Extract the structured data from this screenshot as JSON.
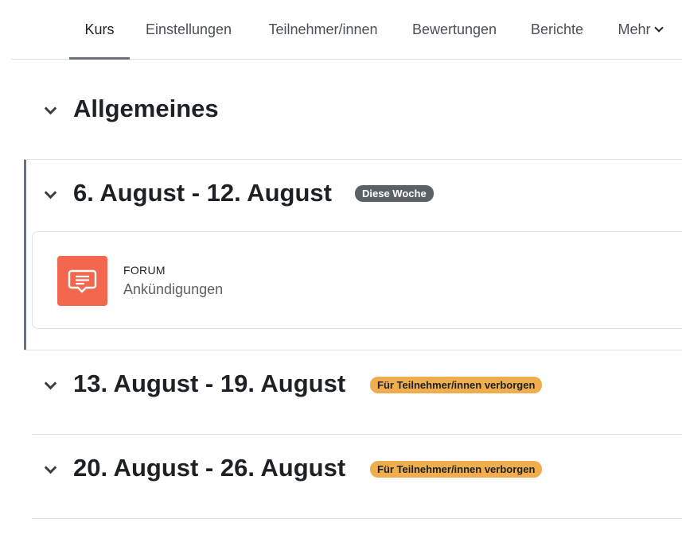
{
  "nav": {
    "tabs": [
      {
        "label": "Kurs",
        "active": true
      },
      {
        "label": "Einstellungen"
      },
      {
        "label": "Teilnehmer/innen"
      },
      {
        "label": "Bewertungen"
      },
      {
        "label": "Berichte"
      },
      {
        "label": "Mehr",
        "icon": "chevron-down-icon"
      }
    ]
  },
  "sections": [
    {
      "title": "Allgemeines",
      "icon": "chevron-down-icon"
    },
    {
      "title": "6. August - 12. August",
      "badge": "Diese Woche",
      "current": true,
      "icon": "chevron-down-icon",
      "activities": [
        {
          "type": "FORUM",
          "name": "Ankündigungen",
          "icon": "forum-icon"
        }
      ]
    },
    {
      "title": "13. August - 19. August",
      "badge": "Für Teilnehmer/innen verborgen",
      "icon": "chevron-down-icon"
    },
    {
      "title": "20. August - 26. August",
      "badge": "Für Teilnehmer/innen verborgen",
      "icon": "chevron-down-icon"
    }
  ],
  "colors": {
    "forum_icon_bg": "#f3674e",
    "badge_current": "#5a6167",
    "badge_hidden": "#f0ad4e"
  }
}
